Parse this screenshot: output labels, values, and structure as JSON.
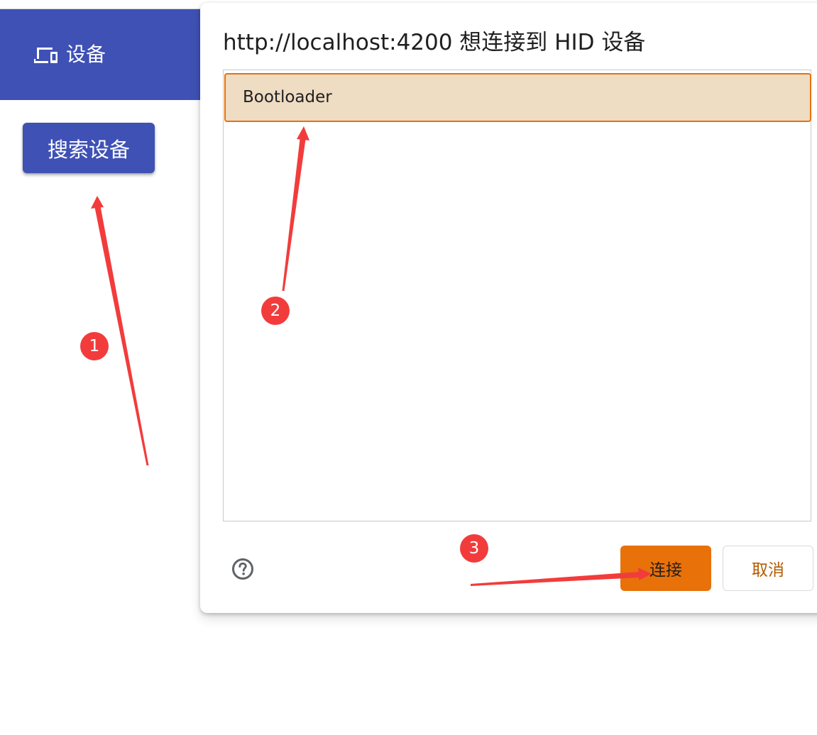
{
  "app": {
    "header_title": "设备",
    "header_icon": "devices-icon",
    "search_button_label": "搜索设备"
  },
  "dialog": {
    "title": "http://localhost:4200 想连接到 HID 设备",
    "devices": [
      {
        "label": "Bootloader",
        "selected": true
      }
    ],
    "help_icon": "help-circle-icon",
    "connect_label": "连接",
    "cancel_label": "取消"
  },
  "annotations": {
    "steps": [
      "1",
      "2",
      "3"
    ],
    "color": "#f23c3c"
  },
  "colors": {
    "primary": "#3f51b5",
    "accent": "#e8710a",
    "selected_bg": "#eedcc3",
    "cancel_text": "#b35a00"
  }
}
